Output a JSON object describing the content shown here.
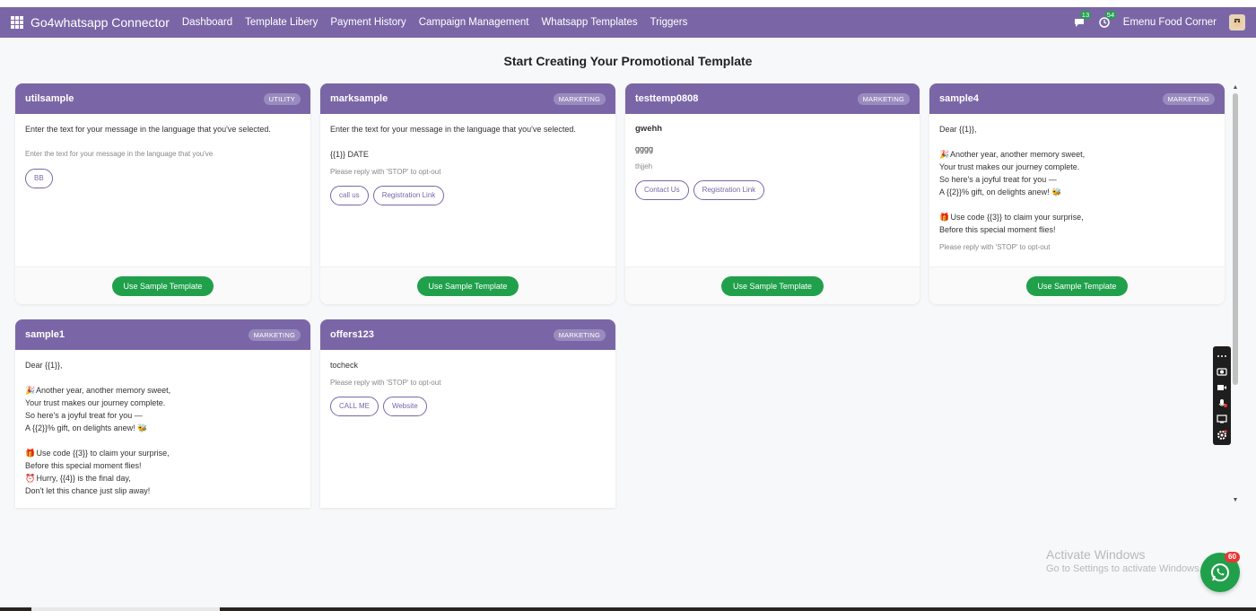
{
  "navbar": {
    "brand": "Go4whatsapp Connector",
    "menu": [
      "Dashboard",
      "Template Libery",
      "Payment History",
      "Campaign Management",
      "Whatsapp Templates",
      "Triggers"
    ],
    "chat_badge": "13",
    "activity_badge": "54",
    "company": "Emenu Food Corner"
  },
  "page": {
    "title": "Start Creating Your Promotional Template"
  },
  "use_button_label": "Use Sample Template",
  "cards": [
    {
      "name": "utilsample",
      "category": "UTILITY",
      "body": "Enter the text for your message in the language that you've selected.",
      "footer": "Enter the text for your message in the language that you've",
      "buttons": [
        "BB"
      ]
    },
    {
      "name": "marksample",
      "category": "MARKETING",
      "body": "Enter the text for your message in the language that you've selected.",
      "body2": "{{1}} DATE",
      "footer": "Please reply with 'STOP' to opt-out",
      "buttons": [
        "call us",
        "Registration Link"
      ]
    },
    {
      "name": "testtemp0808",
      "category": "MARKETING",
      "header": "gwehh",
      "body": "gggg",
      "footer": "thjjeh",
      "buttons": [
        "Contact Us",
        "Registration Link"
      ]
    },
    {
      "name": "sample4",
      "category": "MARKETING",
      "greeting": "Dear {{1}},",
      "lines": [
        "Another year, another memory sweet,",
        "Your trust makes our journey complete.",
        "So here's a joyful treat for you —",
        "A {{2}}% gift, on delights anew!",
        "Use code {{3}} to claim your surprise,",
        "Before this special moment flies!"
      ],
      "footer": "Please reply with 'STOP' to opt-out"
    },
    {
      "name": "sample1",
      "category": "MARKETING",
      "greeting": "Dear {{1}},",
      "lines": [
        "Another year, another memory sweet,",
        "Your trust makes our journey complete.",
        "So here's a joyful treat for you —",
        "A {{2}}% gift, on delights anew!",
        "Use code {{3}} to claim your surprise,",
        "Before this special moment flies!",
        "Hurry, {{4}} is the final day,",
        "Don't let this chance just slip away!"
      ]
    },
    {
      "name": "offers123",
      "category": "MARKETING",
      "body": "tocheck",
      "footer": "Please reply with 'STOP' to opt-out",
      "buttons": [
        "CALL ME",
        "Website"
      ]
    }
  ],
  "watermark": {
    "line1": "Activate Windows",
    "line2": "Go to Settings to activate Windows."
  },
  "whatsapp_badge": "60",
  "colors": {
    "primary": "#7a66a6",
    "success": "#21a04b",
    "danger": "#e53935"
  }
}
